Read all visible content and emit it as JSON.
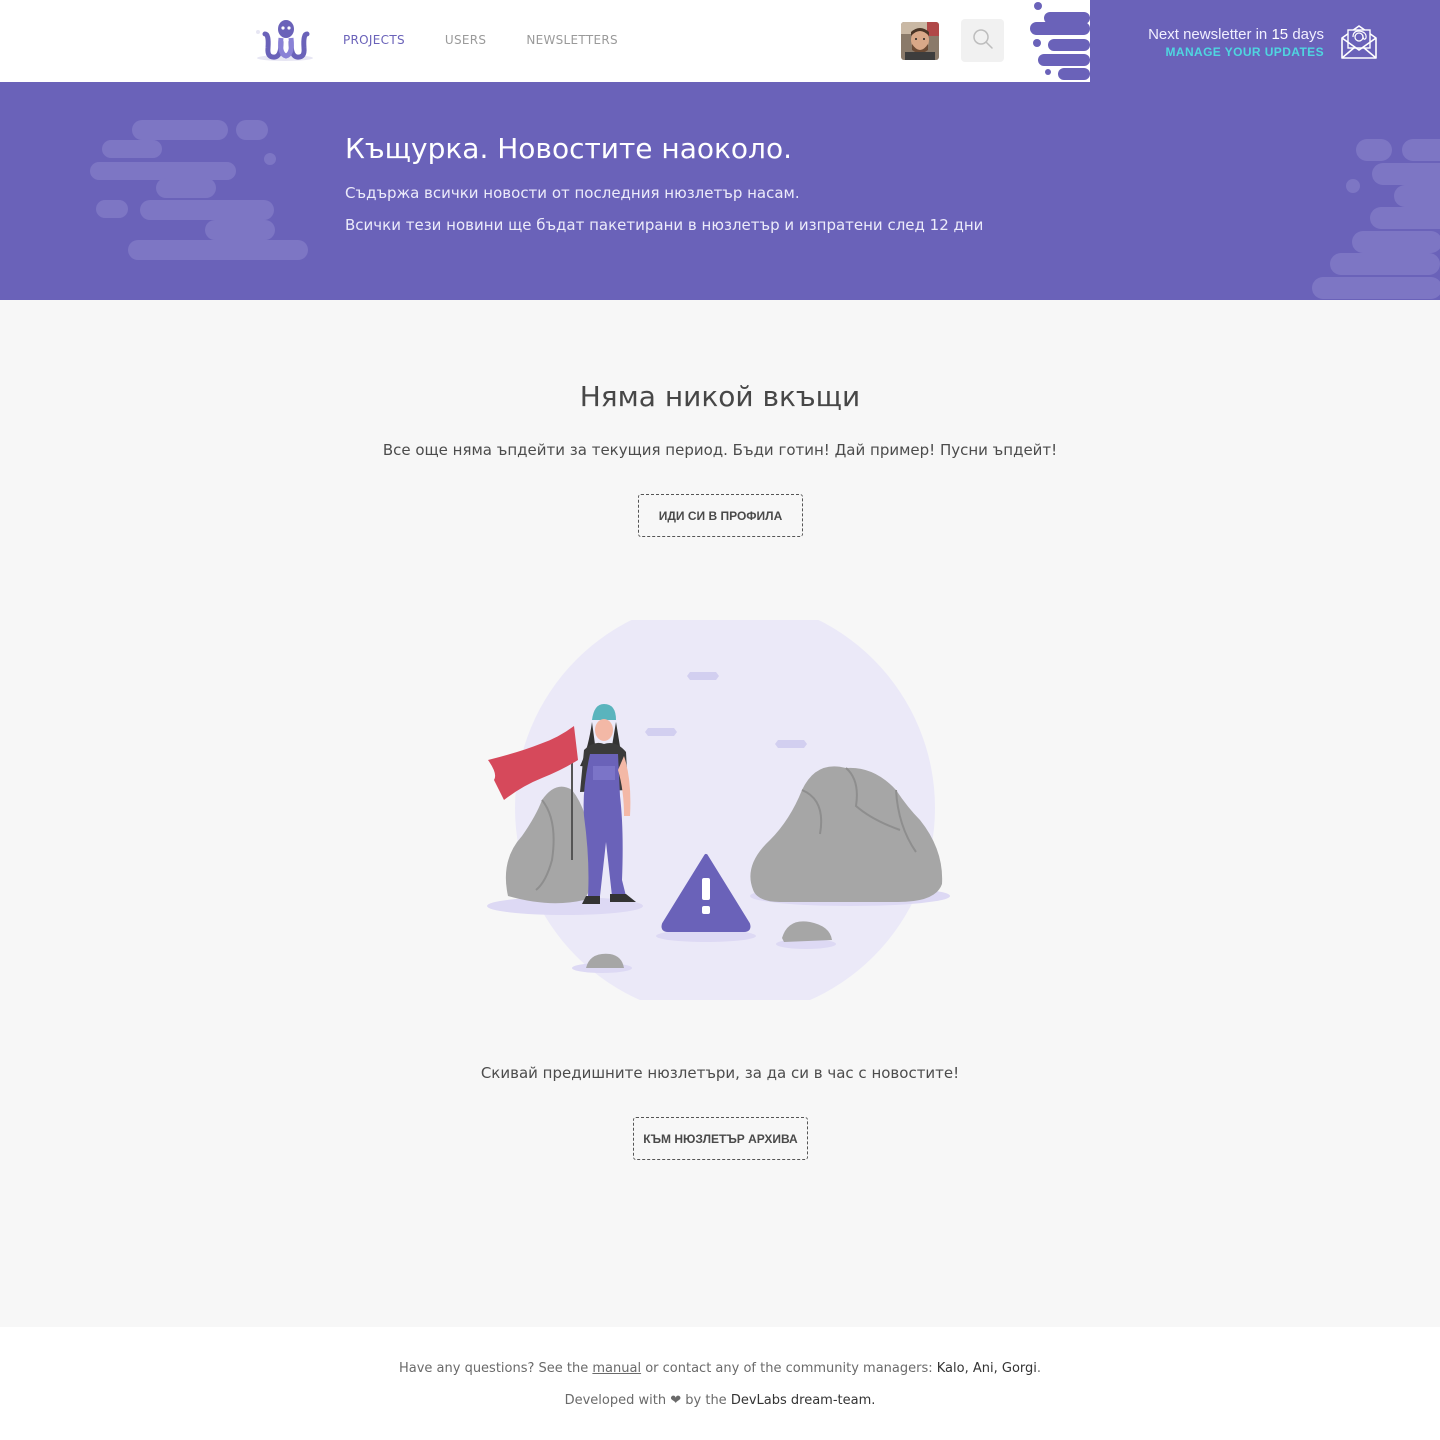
{
  "header": {
    "nav": [
      {
        "label": "PROJECTS",
        "active": true
      },
      {
        "label": "USERS",
        "active": false
      },
      {
        "label": "NEWSLETTERS",
        "active": false
      }
    ],
    "newsletter": {
      "prefix": "Next newsletter in",
      "days": "15",
      "suffix": "days",
      "manage_label": "MANAGE YOUR UPDATES"
    },
    "icons": [
      "octopus-logo",
      "user-avatar",
      "search-icon",
      "mail-icon"
    ]
  },
  "hero": {
    "title": "Къщурка. Новостите наоколо.",
    "line1": "Съдържа всички новости от последния нюзлетър насам.",
    "line2": "Всички тези новини ще бъдат пакетирани в нюзлетър и изпратени след 12 дни"
  },
  "main": {
    "title": "Няма никой вкъщи",
    "text": "Все още няма ъпдейти за текущия период. Бъди готин! Дай пример! Пусни ъпдейт!",
    "profile_button": "ИДИ СИ В ПРОФИЛА",
    "archive_text": "Скивай предишните нюзлетъри, за да си в час с новостите!",
    "archive_button": "КЪМ НЮЗЛЕТЪР АРХИВА"
  },
  "footer": {
    "q_prefix": "Have any questions? See the",
    "manual": "manual",
    "q_middle": "or contact any of the community managers:",
    "managers": "Kalo, Ani, Gorgi",
    "q_end": ".",
    "dev_prefix": "Developed with",
    "heart": "❤",
    "dev_middle": "by the",
    "team": "DevLabs dream-team."
  },
  "colors": {
    "brand_purple": "#6a62b9",
    "accent_cyan": "#4fd6e0",
    "background": "#f7f7f7"
  }
}
